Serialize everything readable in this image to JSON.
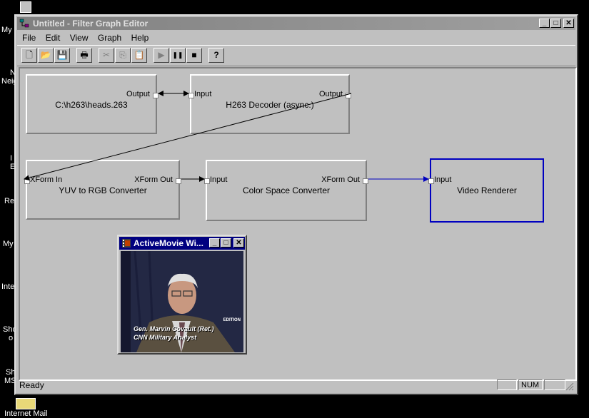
{
  "desktop": {
    "labels": [
      "My",
      "N",
      "Neig",
      "I",
      "E",
      "Re",
      "My",
      "Inte",
      "Sho",
      "o",
      "Sh",
      "MS",
      "Internet Mail"
    ]
  },
  "window": {
    "title": "Untitled - Filter Graph Editor",
    "controls": {
      "minimize": "_",
      "maximize": "□",
      "close": "✕"
    }
  },
  "menu": [
    "File",
    "Edit",
    "View",
    "Graph",
    "Help"
  ],
  "toolbar": [
    {
      "name": "new",
      "glyph": "🗋",
      "enabled": true
    },
    {
      "name": "open",
      "glyph": "📂",
      "enabled": true
    },
    {
      "name": "save",
      "glyph": "💾",
      "enabled": true
    },
    {
      "name": "print",
      "glyph": "🖶",
      "enabled": true
    },
    {
      "name": "cut",
      "glyph": "✂",
      "enabled": false
    },
    {
      "name": "copy",
      "glyph": "⎘",
      "enabled": false
    },
    {
      "name": "paste",
      "glyph": "📋",
      "enabled": false
    },
    {
      "name": "play",
      "glyph": "▶",
      "enabled": false
    },
    {
      "name": "pause",
      "glyph": "❚❚",
      "enabled": true
    },
    {
      "name": "stop",
      "glyph": "■",
      "enabled": true
    },
    {
      "name": "help",
      "glyph": "?",
      "enabled": true
    }
  ],
  "filters": [
    {
      "id": "source",
      "name": "C:\\h263\\heads.263",
      "pins": {
        "out": "Output"
      }
    },
    {
      "id": "decoder",
      "name": "H263 Decoder (async.)",
      "pins": {
        "in": "Input",
        "out": "Output"
      }
    },
    {
      "id": "yuv",
      "name": "YUV to RGB Converter",
      "pins": {
        "in": "XForm In",
        "out": "XForm Out"
      }
    },
    {
      "id": "csc",
      "name": "Color Space Converter",
      "pins": {
        "in": "Input",
        "out": "XForm Out"
      }
    },
    {
      "id": "renderer",
      "name": "Video Renderer",
      "pins": {
        "in": "Input"
      },
      "selected": true
    }
  ],
  "activemovie": {
    "title": "ActiveMovie Wi...",
    "caption_line1": "Gen. Marvin Covault (Ret.)",
    "caption_line2": "CNN Military Analyst",
    "bug": "EDITION"
  },
  "status": {
    "text": "Ready",
    "panels": [
      "",
      "NUM",
      ""
    ]
  },
  "colors": {
    "selected_border": "#0000c0",
    "link": "#000000",
    "selected_link": "#0000c0"
  }
}
